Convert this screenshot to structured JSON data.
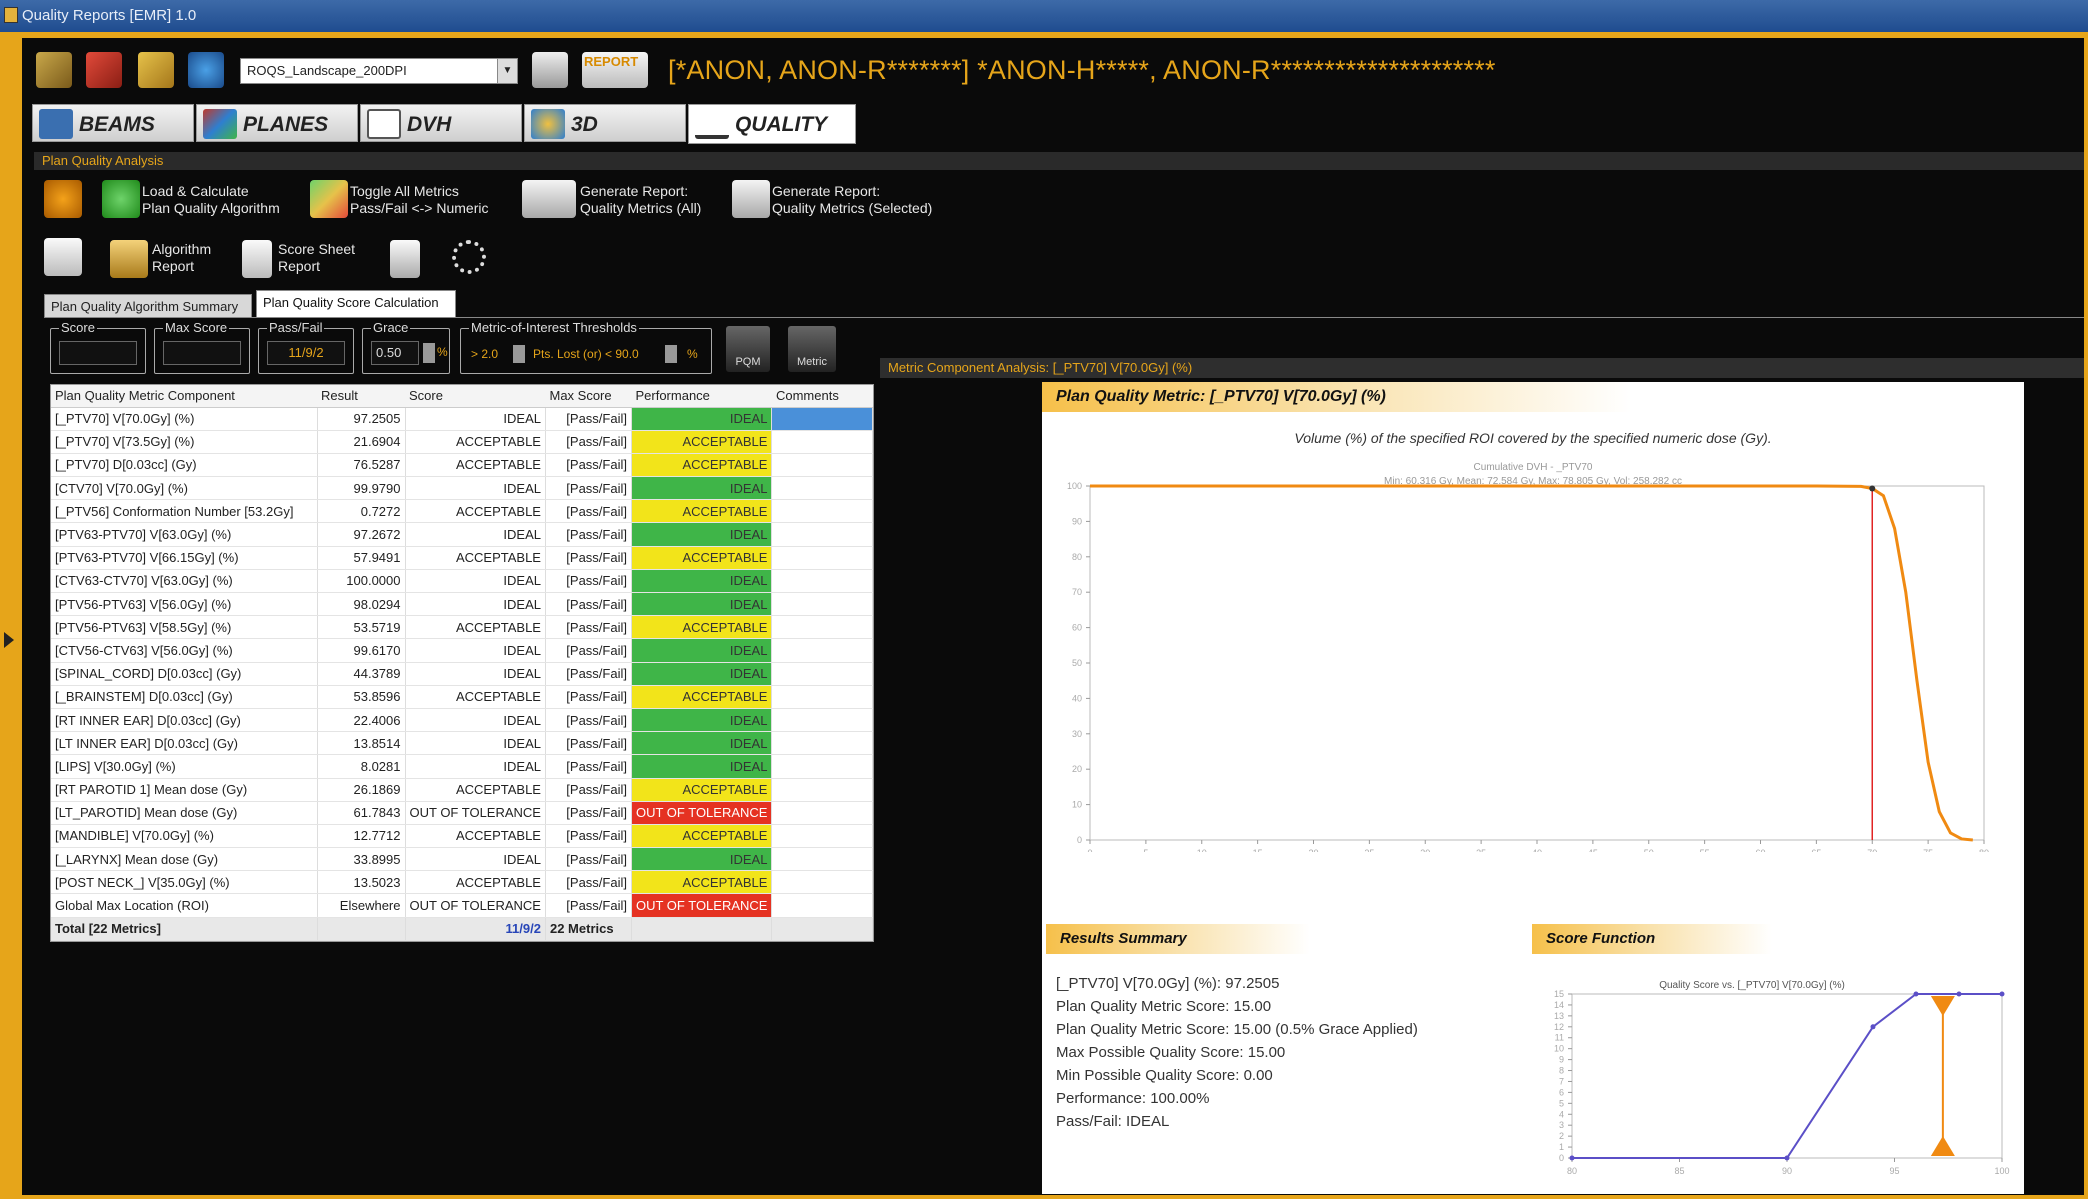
{
  "window": {
    "title": "Quality Reports [EMR] 1.0"
  },
  "toolbar": {
    "template_select": "ROQS_Landscape_200DPI",
    "report_label": "REPORT",
    "patient": "[*ANON, ANON-R*******] *ANON-H*****, ANON-R*********************"
  },
  "tabs": [
    {
      "label": "BEAMS",
      "color": "#3a6fb0"
    },
    {
      "label": "PLANES",
      "color": "#c0392b"
    },
    {
      "label": "DVH",
      "color": "#555555"
    },
    {
      "label": "3D",
      "color": "#2e7fd0"
    },
    {
      "label": "QUALITY",
      "color": "#333333"
    }
  ],
  "section": {
    "title": "Plan Quality Analysis"
  },
  "tools": {
    "load_calc": [
      "Load & Calculate",
      "Plan Quality Algorithm"
    ],
    "toggle": [
      "Toggle All Metrics",
      "Pass/Fail <-> Numeric"
    ],
    "gen_all": [
      "Generate Report:",
      "Quality Metrics (All)"
    ],
    "gen_sel": [
      "Generate Report:",
      "Quality Metrics (Selected)"
    ],
    "algo_report": [
      "Algorithm",
      "Report"
    ],
    "score_sheet": [
      "Score Sheet",
      "Report"
    ]
  },
  "subtabs": [
    "Plan Quality Algorithm Summary",
    "Plan Quality Score Calculation"
  ],
  "fields": {
    "score_label": "Score",
    "maxscore_label": "Max Score",
    "passfail_label": "Pass/Fail",
    "passfail_value": "11/9/2",
    "grace_label": "Grace",
    "grace_value": "0.50",
    "grace_unit": "%",
    "moi_label": "Metric-of-Interest Thresholds",
    "moi_gt": "> 2.0",
    "moi_pts": "Pts. Lost (or) < 90.0",
    "moi_unit": "%",
    "pqm_btn": "PQM",
    "metric_btn": "Metric"
  },
  "grid": {
    "headers": [
      "Plan Quality Metric Component",
      "Result",
      "Score",
      "Max Score",
      "Performance",
      "Comments"
    ],
    "rows": [
      [
        "[_PTV70] V[70.0Gy] (%)",
        "97.2505",
        "IDEAL",
        "[Pass/Fail]",
        "IDEAL",
        ""
      ],
      [
        "[_PTV70] V[73.5Gy] (%)",
        "21.6904",
        "ACCEPTABLE",
        "[Pass/Fail]",
        "ACCEPTABLE",
        ""
      ],
      [
        "[_PTV70] D[0.03cc] (Gy)",
        "76.5287",
        "ACCEPTABLE",
        "[Pass/Fail]",
        "ACCEPTABLE",
        ""
      ],
      [
        "[CTV70] V[70.0Gy] (%)",
        "99.9790",
        "IDEAL",
        "[Pass/Fail]",
        "IDEAL",
        ""
      ],
      [
        "[_PTV56] Conformation Number [53.2Gy]",
        "0.7272",
        "ACCEPTABLE",
        "[Pass/Fail]",
        "ACCEPTABLE",
        ""
      ],
      [
        "[PTV63-PTV70] V[63.0Gy] (%)",
        "97.2672",
        "IDEAL",
        "[Pass/Fail]",
        "IDEAL",
        ""
      ],
      [
        "[PTV63-PTV70] V[66.15Gy] (%)",
        "57.9491",
        "ACCEPTABLE",
        "[Pass/Fail]",
        "ACCEPTABLE",
        ""
      ],
      [
        "[CTV63-CTV70] V[63.0Gy] (%)",
        "100.0000",
        "IDEAL",
        "[Pass/Fail]",
        "IDEAL",
        ""
      ],
      [
        "[PTV56-PTV63] V[56.0Gy] (%)",
        "98.0294",
        "IDEAL",
        "[Pass/Fail]",
        "IDEAL",
        ""
      ],
      [
        "[PTV56-PTV63] V[58.5Gy] (%)",
        "53.5719",
        "ACCEPTABLE",
        "[Pass/Fail]",
        "ACCEPTABLE",
        ""
      ],
      [
        "[CTV56-CTV63] V[56.0Gy] (%)",
        "99.6170",
        "IDEAL",
        "[Pass/Fail]",
        "IDEAL",
        ""
      ],
      [
        "[SPINAL_CORD] D[0.03cc] (Gy)",
        "44.3789",
        "IDEAL",
        "[Pass/Fail]",
        "IDEAL",
        ""
      ],
      [
        "[_BRAINSTEM] D[0.03cc] (Gy)",
        "53.8596",
        "ACCEPTABLE",
        "[Pass/Fail]",
        "ACCEPTABLE",
        ""
      ],
      [
        "[RT INNER EAR] D[0.03cc] (Gy)",
        "22.4006",
        "IDEAL",
        "[Pass/Fail]",
        "IDEAL",
        ""
      ],
      [
        "[LT INNER EAR] D[0.03cc] (Gy)",
        "13.8514",
        "IDEAL",
        "[Pass/Fail]",
        "IDEAL",
        ""
      ],
      [
        "[LIPS] V[30.0Gy] (%)",
        "8.0281",
        "IDEAL",
        "[Pass/Fail]",
        "IDEAL",
        ""
      ],
      [
        "[RT PAROTID 1] Mean dose (Gy)",
        "26.1869",
        "ACCEPTABLE",
        "[Pass/Fail]",
        "ACCEPTABLE",
        ""
      ],
      [
        "[LT_PAROTID] Mean dose (Gy)",
        "61.7843",
        "OUT OF TOLERANCE",
        "[Pass/Fail]",
        "OUT OF TOLERANCE",
        ""
      ],
      [
        "[MANDIBLE] V[70.0Gy] (%)",
        "12.7712",
        "ACCEPTABLE",
        "[Pass/Fail]",
        "ACCEPTABLE",
        ""
      ],
      [
        "[_LARYNX] Mean dose (Gy)",
        "33.8995",
        "IDEAL",
        "[Pass/Fail]",
        "IDEAL",
        ""
      ],
      [
        "[POST NECK_] V[35.0Gy] (%)",
        "13.5023",
        "ACCEPTABLE",
        "[Pass/Fail]",
        "ACCEPTABLE",
        ""
      ],
      [
        "Global Max Location (ROI)",
        "Elsewhere",
        "OUT OF TOLERANCE",
        "[Pass/Fail]",
        "OUT OF TOLERANCE",
        ""
      ]
    ],
    "total": [
      "Total [22 Metrics]",
      "",
      "11/9/2",
      "22 Metrics",
      "",
      ""
    ],
    "perf_colors": {
      "IDEAL": "#3fb548",
      "ACCEPTABLE": "#f2e41a",
      "OUT OF TOLERANCE": "#e53222"
    }
  },
  "analysis": {
    "header": "Metric Component Analysis: [_PTV70] V[70.0Gy] (%)",
    "title": "Plan Quality Metric: [_PTV70] V[70.0Gy] (%)",
    "description": "Volume (%) of the specified ROI covered by the specified numeric dose (Gy).",
    "dvh_title": "Cumulative DVH - _PTV70",
    "dvh_subtitle": "Min: 60.316 Gy, Mean: 72.584 Gy, Max: 78.805 Gy, Vol: 258.282 cc",
    "results_title": "Results Summary",
    "score_fn_title": "Score Function",
    "score_fn_chart_title": "Quality Score vs. [_PTV70] V[70.0Gy] (%)",
    "summary": [
      "[_PTV70] V[70.0Gy] (%): 97.2505",
      "Plan Quality Metric Score: 15.00",
      "Plan Quality Metric Score: 15.00 (0.5% Grace Applied)",
      "Max Possible Quality Score: 15.00",
      "Min Possible Quality Score: 0.00",
      "Performance: 100.00%",
      "Pass/Fail: IDEAL"
    ],
    "accent": "#f08a12",
    "marker_color": "#e12424"
  },
  "chart_data": [
    {
      "type": "line",
      "title": "Cumulative DVH - _PTV70",
      "xlim": [
        0,
        80
      ],
      "ylim": [
        0,
        100
      ],
      "x": [
        0,
        60,
        65,
        69,
        70,
        71,
        72,
        73,
        74,
        75,
        76,
        77,
        78,
        79
      ],
      "series": [
        {
          "values": [
            100,
            100,
            100,
            99.9,
            99.3,
            97.25,
            88,
            70,
            45,
            22,
            8,
            2,
            0.3,
            0
          ]
        }
      ],
      "marker_x": 70
    },
    {
      "type": "line",
      "title": "Quality Score vs. [_PTV70] V[70.0Gy] (%)",
      "xlim": [
        80,
        100
      ],
      "ylim": [
        0,
        15
      ],
      "x": [
        80,
        90,
        94,
        96,
        98,
        100
      ],
      "series": [
        {
          "values": [
            0,
            0,
            12,
            15,
            15,
            15
          ]
        }
      ],
      "marker_x": 97.25
    }
  ]
}
